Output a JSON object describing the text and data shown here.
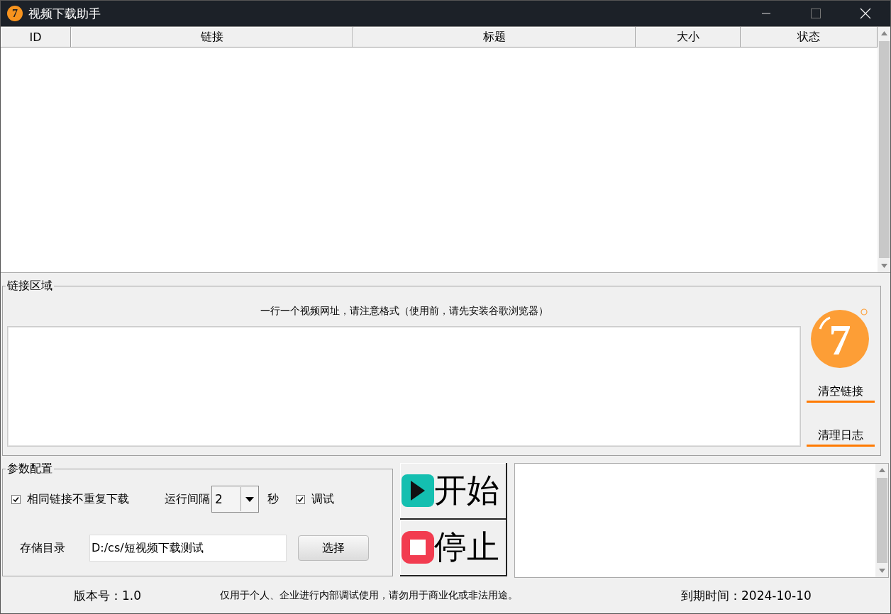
{
  "window": {
    "title": "视频下载助手",
    "logo_text": "7"
  },
  "table": {
    "columns": [
      "ID",
      "链接",
      "标题",
      "大小",
      "状态"
    ]
  },
  "link_area": {
    "title": "链接区域",
    "hint": "一行一个视频网址，请注意格式（使用前，请先安装谷歌浏览器）",
    "logo_text": "7",
    "buttons": [
      "清空链接",
      "清理日志"
    ]
  },
  "params": {
    "title": "参数配置",
    "skip_duplicates": {
      "label": "相同链接不重复下载",
      "checked": true
    },
    "interval": {
      "label": "运行间隔",
      "value": "2",
      "unit": "秒"
    },
    "debug": {
      "label": "调试",
      "checked": true
    },
    "storage": {
      "label": "存储目录",
      "value": "D:/cs/短视频下载测试",
      "button": "选择"
    }
  },
  "actions": [
    {
      "kind": "start",
      "label": "开始"
    },
    {
      "kind": "stop",
      "label": "停止"
    }
  ],
  "footer": {
    "version": "版本号：1.0",
    "notice": "仅用于个人、企业进行内部调试使用，请勿用于商业化或非法用途。",
    "expiry": "到期时间：2024-10-10"
  }
}
